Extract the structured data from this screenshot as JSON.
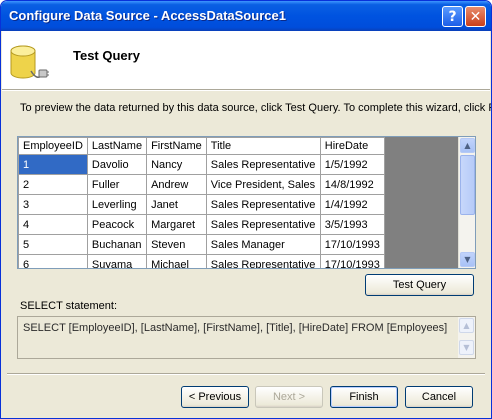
{
  "window": {
    "title": "Configure Data Source - AccessDataSource1"
  },
  "titlebar_buttons": {
    "help": "?",
    "close": "✕"
  },
  "header": {
    "title": "Test Query",
    "icon": "database-plug-icon"
  },
  "instruction": "To preview the data returned by this data source, click Test Query. To complete this wizard, click Finish.",
  "grid": {
    "columns": [
      "EmployeeID",
      "LastName",
      "FirstName",
      "Title",
      "HireDate"
    ],
    "rows": [
      [
        "1",
        "Davolio",
        "Nancy",
        "Sales Representative",
        "1/5/1992"
      ],
      [
        "2",
        "Fuller",
        "Andrew",
        "Vice President, Sales",
        "14/8/1992"
      ],
      [
        "3",
        "Leverling",
        "Janet",
        "Sales Representative",
        "1/4/1992"
      ],
      [
        "4",
        "Peacock",
        "Margaret",
        "Sales Representative",
        "3/5/1993"
      ],
      [
        "5",
        "Buchanan",
        "Steven",
        "Sales Manager",
        "17/10/1993"
      ],
      [
        "6",
        "Suyama",
        "Michael",
        "Sales Representative",
        "17/10/1993"
      ]
    ],
    "selected_cell": "1"
  },
  "test_query_button": "Test Query",
  "select_statement": {
    "label": "SELECT statement:",
    "value": "SELECT [EmployeeID], [LastName], [FirstName], [Title], [HireDate] FROM [Employees]"
  },
  "footer": {
    "previous": "< Previous",
    "next": "Next >",
    "finish": "Finish",
    "cancel": "Cancel"
  },
  "colors": {
    "titlebar": "#0053e0",
    "selection": "#316ac5",
    "dialog_bg": "#ece9d8"
  }
}
